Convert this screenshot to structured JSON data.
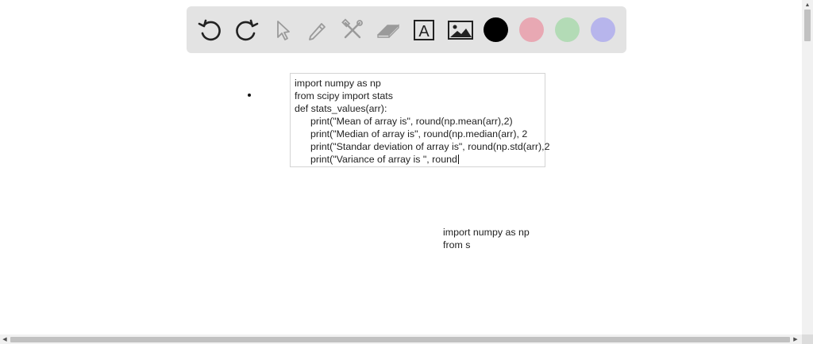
{
  "toolbar": {
    "tools": [
      {
        "icon": "undo-icon"
      },
      {
        "icon": "redo-icon"
      },
      {
        "icon": "pointer-icon"
      },
      {
        "icon": "pencil-icon"
      },
      {
        "icon": "tools-icon"
      },
      {
        "icon": "eraser-icon"
      },
      {
        "icon": "text-box-icon",
        "glyph": "A"
      },
      {
        "icon": "image-icon"
      }
    ],
    "colors": [
      {
        "name": "black",
        "hex": "#000000"
      },
      {
        "name": "pink",
        "hex": "#e8a8b3"
      },
      {
        "name": "green",
        "hex": "#b3dbb6"
      },
      {
        "name": "lavender",
        "hex": "#b7b5ec"
      }
    ]
  },
  "canvas": {
    "textbox_lines": [
      "import numpy as np",
      "from scipy import stats",
      "def stats_values(arr):",
      "print(\"Mean of array is\", round(np.mean(arr),2)",
      "print(\"Median of array is\", round(np.median(arr), 2",
      "print(\"Standar deviation of array is\", round(np.std(arr),2",
      "print(\"Variance of array is \", round"
    ],
    "loose_text_lines": [
      "import numpy as np",
      "from s"
    ]
  }
}
